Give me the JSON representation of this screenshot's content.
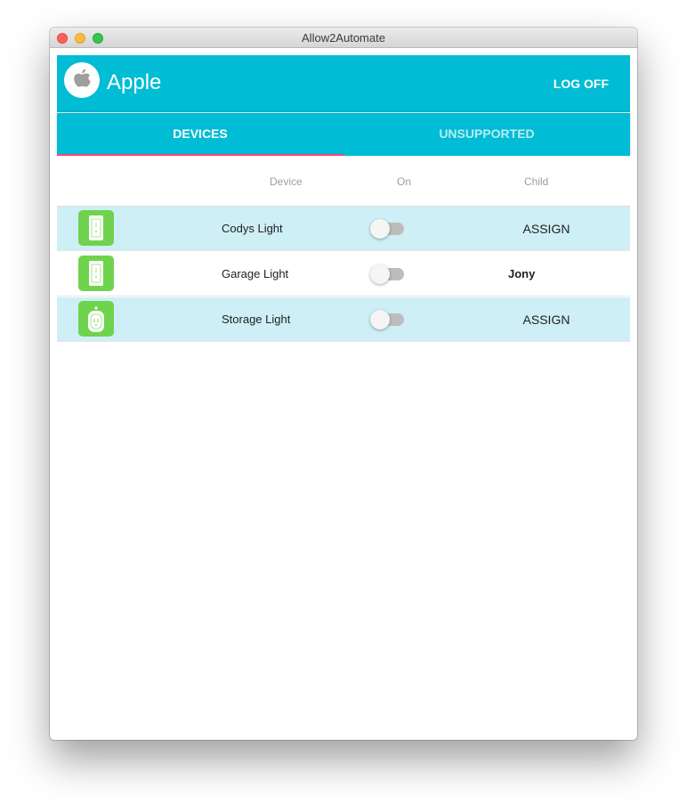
{
  "window": {
    "title": "Allow2Automate",
    "traffic_lights": {
      "close": "#fc605b",
      "minimize": "#fdbc40",
      "maximize": "#34c84a"
    }
  },
  "appbar": {
    "title": "Apple",
    "logo_icon": "apple-logo-icon",
    "logoff_label": "LOG OFF",
    "color": "#00bcd4"
  },
  "tabs": [
    {
      "label": "DEVICES",
      "selected": true
    },
    {
      "label": "UNSUPPORTED",
      "selected": false
    }
  ],
  "table": {
    "headers": {
      "device": "Device",
      "on": "On",
      "child": "Child"
    },
    "rows": [
      {
        "icon": "wall-switch-icon",
        "device": "Codys Light",
        "on": false,
        "child": "",
        "action": "ASSIGN"
      },
      {
        "icon": "wall-switch-icon",
        "device": "Garage Light",
        "on": false,
        "child": "Jony",
        "action": ""
      },
      {
        "icon": "smart-plug-icon",
        "device": "Storage Light",
        "on": false,
        "child": "",
        "action": "ASSIGN"
      }
    ]
  },
  "colors": {
    "accent": "#00bcd4",
    "tab_indicator": "#ff4081",
    "device_icon_bg": "#6fd34e",
    "row_stripe": "#cdeff5"
  }
}
